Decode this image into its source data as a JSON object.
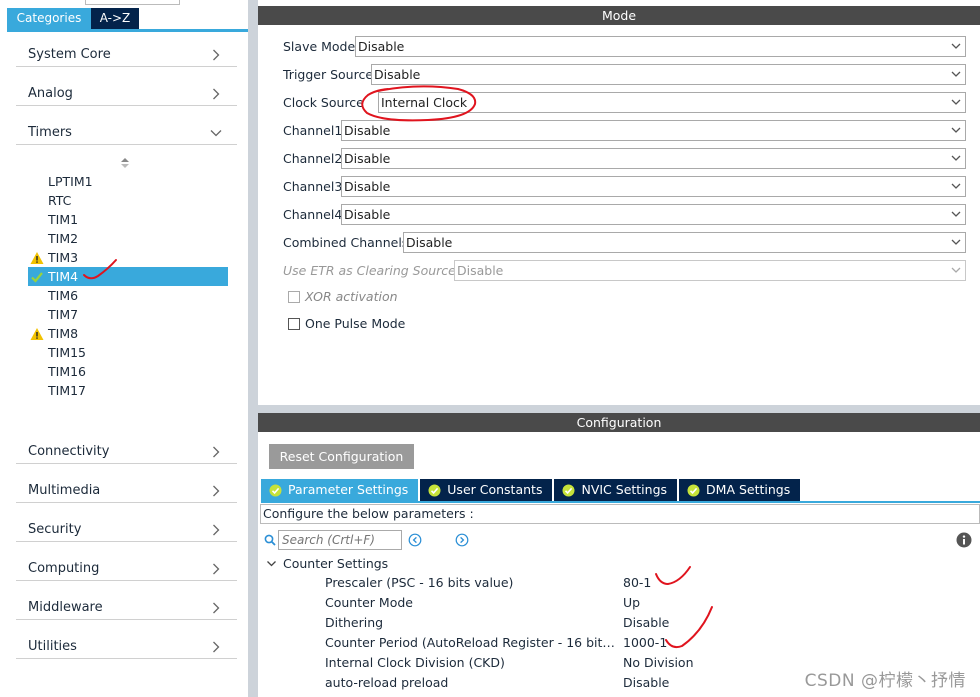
{
  "left_panel": {
    "tabs": [
      {
        "label": "Categories",
        "active": true
      },
      {
        "label": "A->Z",
        "active": false
      }
    ],
    "categories_top": [
      {
        "label": "System Core",
        "chevron": "right"
      },
      {
        "label": "Analog",
        "chevron": "right"
      },
      {
        "label": "Timers",
        "chevron": "down"
      }
    ],
    "timers": [
      {
        "label": "LPTIM1",
        "status": ""
      },
      {
        "label": "RTC",
        "status": ""
      },
      {
        "label": "TIM1",
        "status": ""
      },
      {
        "label": "TIM2",
        "status": ""
      },
      {
        "label": "TIM3",
        "status": "warning-icon"
      },
      {
        "label": "TIM4",
        "status": "check-icon",
        "selected": true
      },
      {
        "label": "TIM6",
        "status": ""
      },
      {
        "label": "TIM7",
        "status": ""
      },
      {
        "label": "TIM8",
        "status": "warning-icon"
      },
      {
        "label": "TIM15",
        "status": ""
      },
      {
        "label": "TIM16",
        "status": ""
      },
      {
        "label": "TIM17",
        "status": ""
      }
    ],
    "categories_bottom": [
      {
        "label": "Connectivity",
        "chevron": "right"
      },
      {
        "label": "Multimedia",
        "chevron": "right"
      },
      {
        "label": "Security",
        "chevron": "right"
      },
      {
        "label": "Computing",
        "chevron": "right"
      },
      {
        "label": "Middleware",
        "chevron": "right"
      },
      {
        "label": "Utilities",
        "chevron": "right"
      }
    ]
  },
  "mode": {
    "title": "Mode",
    "fields": [
      {
        "label": "Slave Mode",
        "value": "Disable",
        "enabled": true
      },
      {
        "label": "Trigger Source",
        "value": "Disable",
        "enabled": true
      },
      {
        "label": "Clock Source",
        "value": "Internal Clock",
        "enabled": true
      },
      {
        "label": "Channel1",
        "value": "Disable",
        "enabled": true
      },
      {
        "label": "Channel2",
        "value": "Disable",
        "enabled": true
      },
      {
        "label": "Channel3",
        "value": "Disable",
        "enabled": true
      },
      {
        "label": "Channel4",
        "value": "Disable",
        "enabled": true
      },
      {
        "label": "Combined Channels",
        "value": "Disable",
        "enabled": true
      },
      {
        "label": "Use ETR as Clearing Source",
        "value": "Disable",
        "enabled": false
      }
    ],
    "checkboxes": [
      {
        "label": "XOR activation",
        "checked": false,
        "enabled": false
      },
      {
        "label": "One Pulse Mode",
        "checked": false,
        "enabled": true
      }
    ]
  },
  "configuration": {
    "title": "Configuration",
    "reset_label": "Reset Configuration",
    "tabs": [
      {
        "label": "Parameter Settings",
        "active": true
      },
      {
        "label": "User Constants",
        "active": false
      },
      {
        "label": "NVIC Settings",
        "active": false
      },
      {
        "label": "DMA Settings",
        "active": false
      }
    ],
    "description": "Configure the below parameters :",
    "search_placeholder": "Search (Crtl+F)",
    "group_label": "Counter Settings",
    "params": [
      {
        "name": "Prescaler (PSC - 16 bits value)",
        "value": "80-1"
      },
      {
        "name": "Counter Mode",
        "value": "Up"
      },
      {
        "name": "Dithering",
        "value": "Disable"
      },
      {
        "name": "Counter Period (AutoReload Register - 16 bits value )",
        "value": "1000-1"
      },
      {
        "name": "Internal Clock Division (CKD)",
        "value": "No Division"
      },
      {
        "name": "auto-reload preload",
        "value": "Disable"
      }
    ]
  },
  "watermark": "CSDN @柠檬丶抒情",
  "colors": {
    "accent": "#39a9dc",
    "dark_tab": "#03234b",
    "header": "#4a4a4a",
    "annotation": "#e0141e"
  }
}
